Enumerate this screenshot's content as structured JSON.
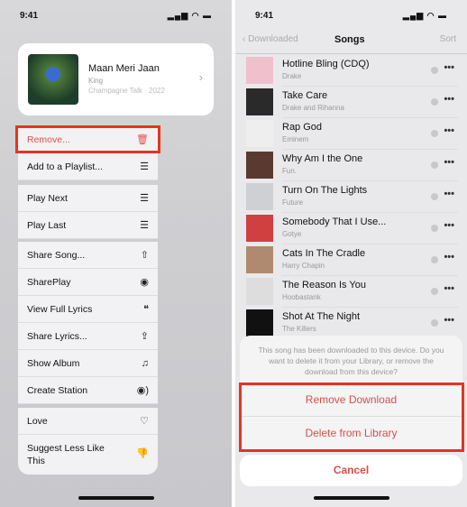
{
  "left": {
    "time": "9:41",
    "status_icons": "signal wifi battery",
    "song": {
      "title": "Maan Meri Jaan",
      "artist": "King",
      "album": "Champagne Talk · 2022"
    },
    "menu": [
      {
        "label": "Remove...",
        "icon": "trash-icon",
        "glyph": "🗑"
      },
      {
        "label": "Add to a Playlist...",
        "icon": "add-playlist-icon",
        "glyph": "☰"
      },
      {
        "label": "Play Next",
        "icon": "play-next-icon",
        "glyph": "☰"
      },
      {
        "label": "Play Last",
        "icon": "play-last-icon",
        "glyph": "☰"
      },
      {
        "label": "Share Song...",
        "icon": "share-icon",
        "glyph": "⇧"
      },
      {
        "label": "SharePlay",
        "icon": "shareplay-icon",
        "glyph": "◉"
      },
      {
        "label": "View Full Lyrics",
        "icon": "lyrics-icon",
        "glyph": "❝"
      },
      {
        "label": "Share Lyrics...",
        "icon": "share-lyrics-icon",
        "glyph": "⇪"
      },
      {
        "label": "Show Album",
        "icon": "album-icon",
        "glyph": "♫"
      },
      {
        "label": "Create Station",
        "icon": "station-icon",
        "glyph": "◉)"
      },
      {
        "label": "Love",
        "icon": "heart-icon",
        "glyph": "♡"
      },
      {
        "label": "Suggest Less Like This",
        "icon": "thumbs-down-icon",
        "glyph": "👎"
      }
    ]
  },
  "right": {
    "time": "9:41",
    "nav": {
      "back": "Downloaded",
      "title": "Songs",
      "sort": "Sort"
    },
    "songs": [
      {
        "title": "Hotline Bling (CDQ)",
        "artist": "Drake",
        "color": "#f0c0cc"
      },
      {
        "title": "Take Care",
        "artist": "Drake and Rihanna",
        "color": "#2a2a2a"
      },
      {
        "title": "Rap God",
        "artist": "Eminem",
        "color": "#eeeeee"
      },
      {
        "title": "Why Am I the One",
        "artist": "Fun.",
        "color": "#5a3a30"
      },
      {
        "title": "Turn On The Lights",
        "artist": "Future",
        "color": "#cfd0d4"
      },
      {
        "title": "Somebody That I Use...",
        "artist": "Gotye",
        "color": "#d04040"
      },
      {
        "title": "Cats In The Cradle",
        "artist": "Harry Chapin",
        "color": "#b08a70"
      },
      {
        "title": "The Reason Is You",
        "artist": "Hoobastank",
        "color": "#dddddd"
      },
      {
        "title": "Shot At The Night",
        "artist": "The Killers",
        "color": "#111111"
      }
    ],
    "sheet": {
      "message": "This song has been downloaded to this device. Do you want to delete it from your Library, or remove the download from this device?",
      "remove": "Remove Download",
      "delete": "Delete from Library",
      "cancel": "Cancel"
    }
  },
  "colors": {
    "destructive": "#d2504a",
    "highlight": "#e8331f"
  }
}
